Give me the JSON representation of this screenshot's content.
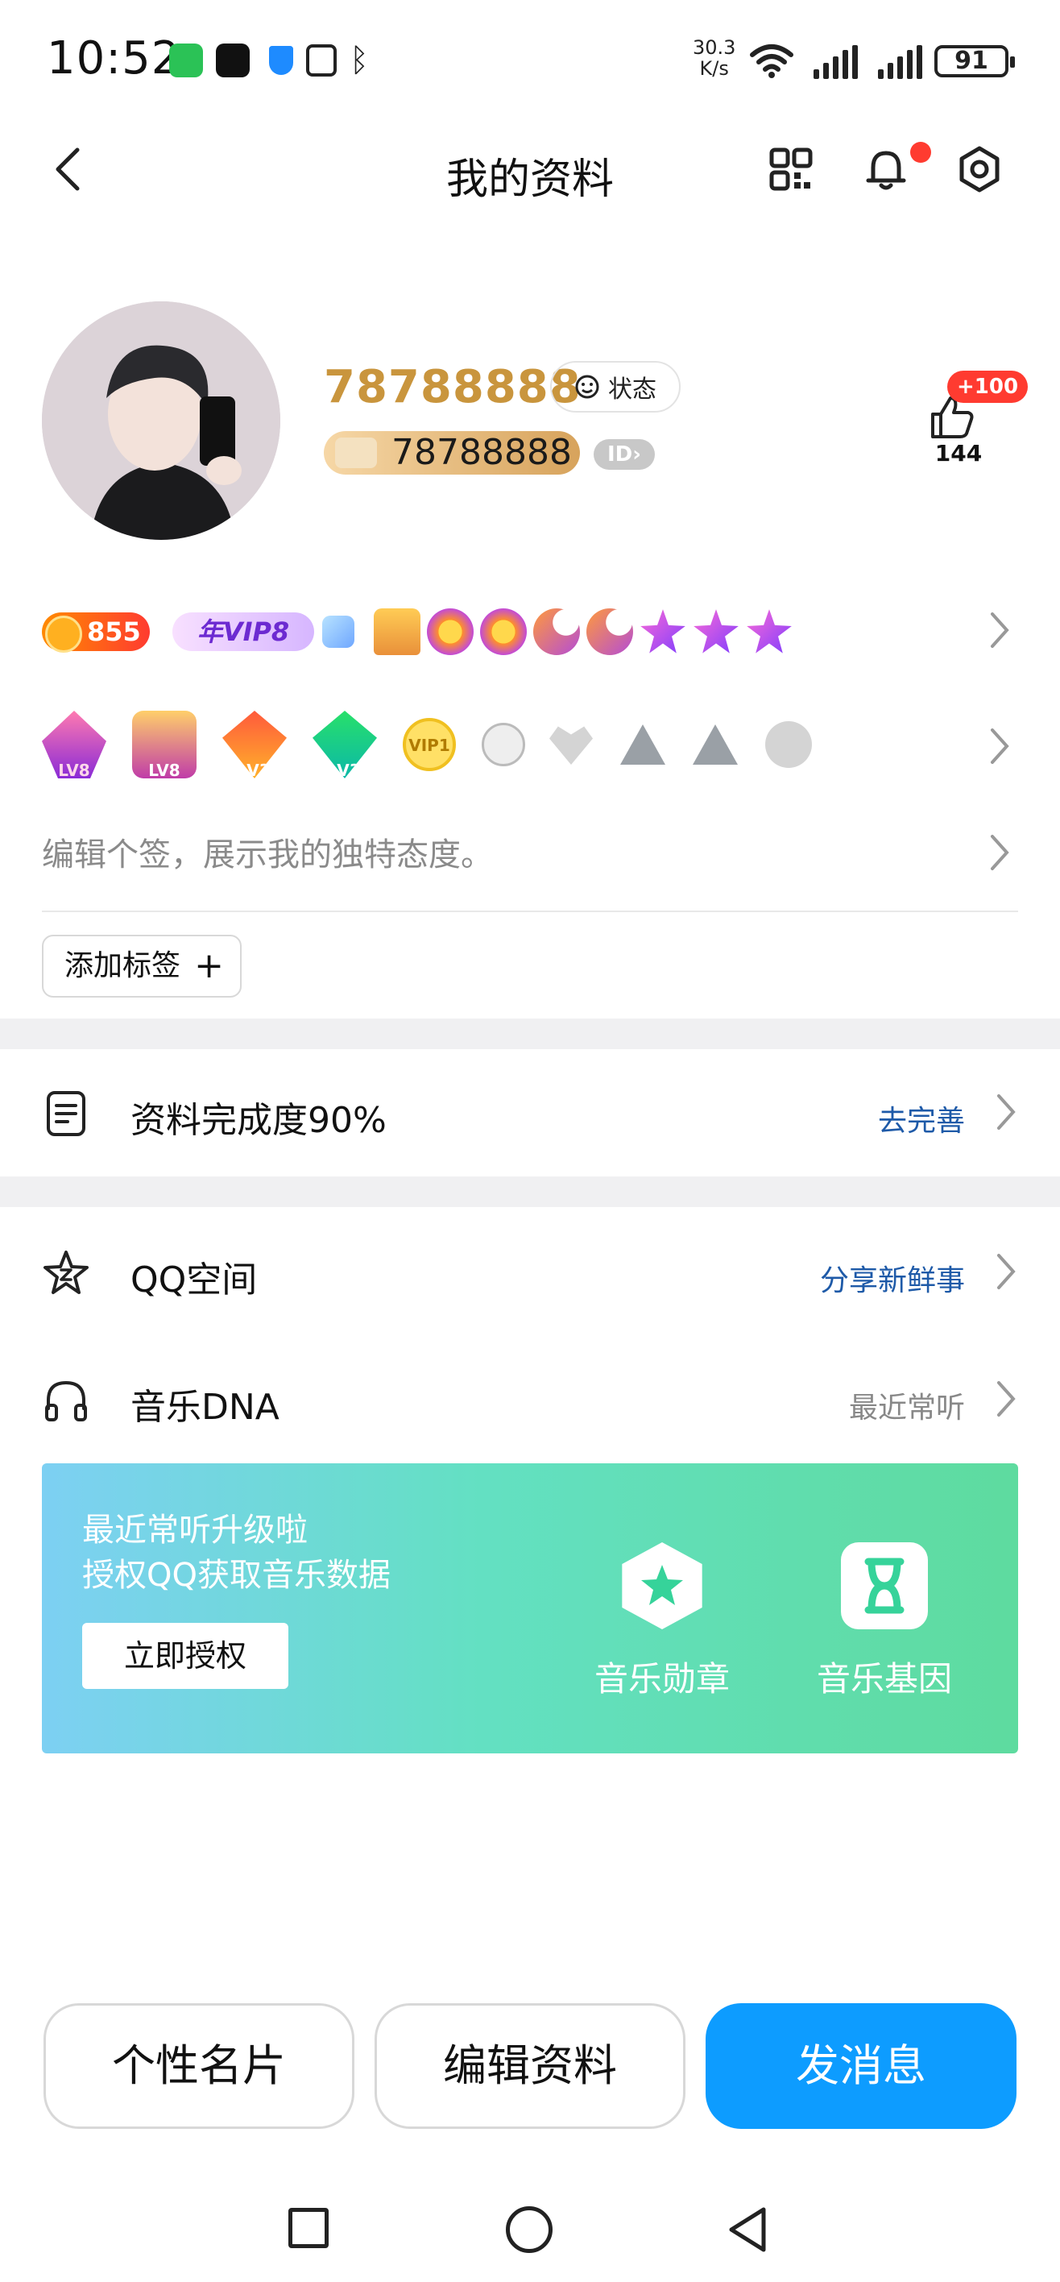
{
  "status_bar": {
    "time": "10:52",
    "net_speed_value": "30.3",
    "net_speed_unit": "K/s",
    "battery": "91"
  },
  "header": {
    "title": "我的资料",
    "icons": [
      "back-icon",
      "qr-code-icon",
      "bell-icon",
      "gear-icon"
    ],
    "notification_dot_color": "#ff3b30"
  },
  "profile": {
    "nickname": "78788888",
    "status_label": "状态",
    "qq_id": "78788888",
    "id_badge": "ID",
    "likes_plus": "+100",
    "likes_count": "144",
    "accent_color": "#c9953d"
  },
  "badges": {
    "coin": "855",
    "vip": "年VIP8",
    "game_badges": [
      "LV8",
      "LV8",
      "LV3",
      "LV3",
      "VIP1"
    ]
  },
  "signature": {
    "placeholder": "编辑个签，展示我的独特态度。"
  },
  "tags": {
    "add_label": "添加标签",
    "add_symbol": "+"
  },
  "completion": {
    "label": "资料完成度90%",
    "action": "去完善",
    "action_color": "#1e5aa8"
  },
  "qzone": {
    "label": "QQ空间",
    "action": "分享新鲜事"
  },
  "music": {
    "label": "音乐DNA",
    "action": "最近常听",
    "banner": {
      "line1": "最近常听升级啦",
      "line2": "授权QQ获取音乐数据",
      "button": "立即授权",
      "feature1": "音乐勋章",
      "feature2": "音乐基因"
    }
  },
  "actions": {
    "card": "个性名片",
    "edit": "编辑资料",
    "message": "发消息",
    "primary_color": "#0d9cff"
  }
}
